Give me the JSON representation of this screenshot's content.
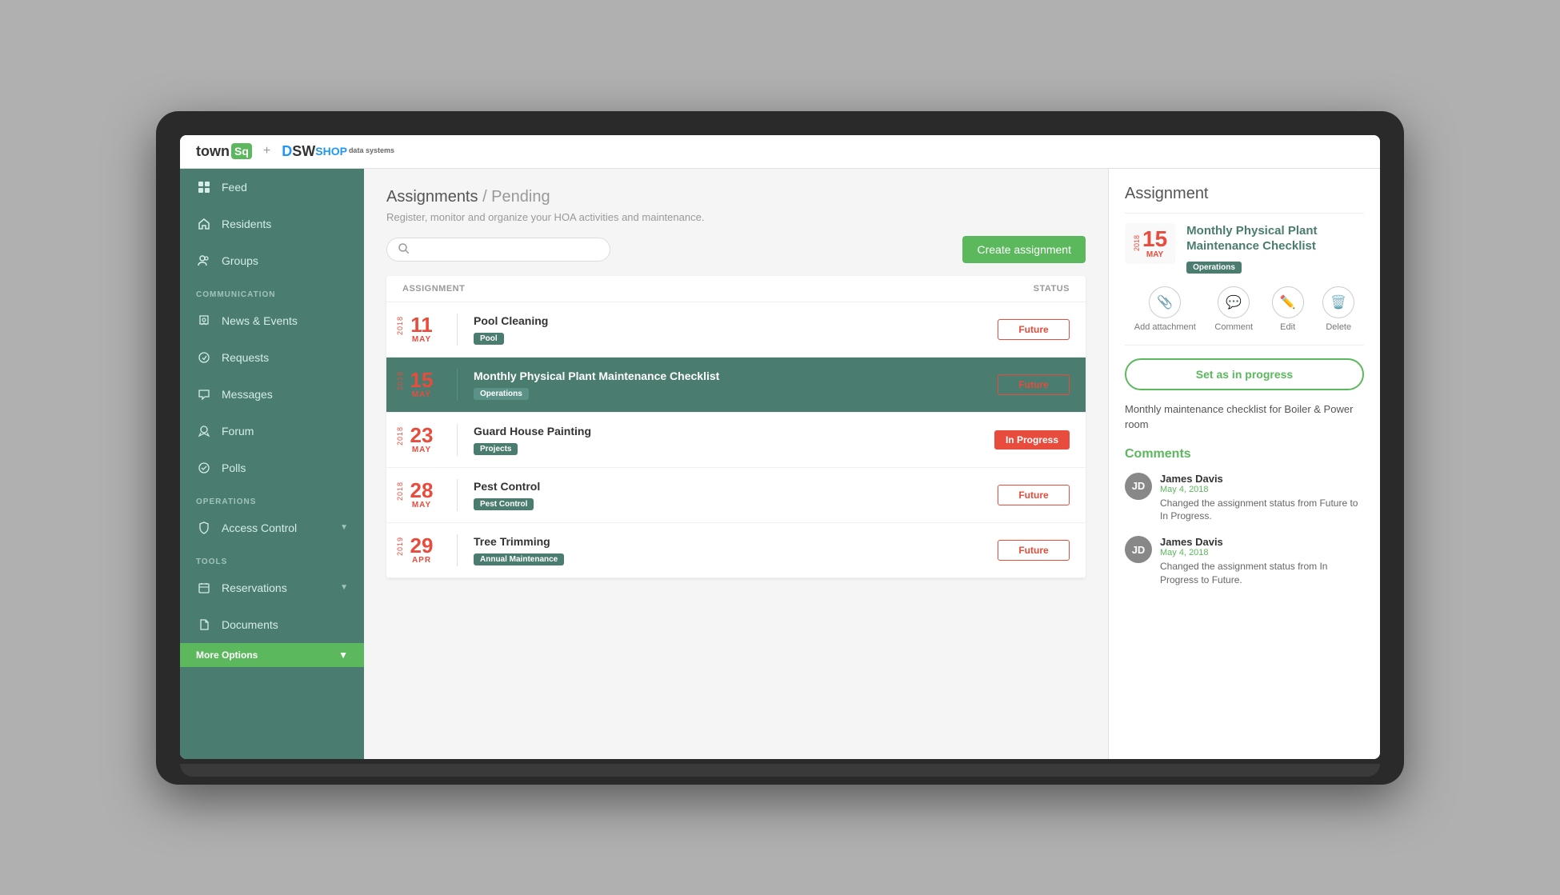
{
  "app": {
    "top_bar": {
      "logo_town": "town",
      "logo_sq": "Sq",
      "plus": "+",
      "dsw_d": "D",
      "dsw_s": "S",
      "dsw_w": "W",
      "dsw_shop": "SHOP",
      "dsw_sub": "data systems"
    }
  },
  "sidebar": {
    "items": [
      {
        "id": "feed",
        "label": "Feed",
        "icon": "grid-icon"
      },
      {
        "id": "residents",
        "label": "Residents",
        "icon": "home-icon"
      },
      {
        "id": "groups",
        "label": "Groups",
        "icon": "groups-icon"
      }
    ],
    "sections": [
      {
        "label": "COMMUNICATION",
        "items": [
          {
            "id": "news-events",
            "label": "News & Events",
            "icon": "news-icon"
          },
          {
            "id": "requests",
            "label": "Requests",
            "icon": "requests-icon"
          },
          {
            "id": "messages",
            "label": "Messages",
            "icon": "messages-icon"
          },
          {
            "id": "forum",
            "label": "Forum",
            "icon": "forum-icon"
          },
          {
            "id": "polls",
            "label": "Polls",
            "icon": "polls-icon"
          }
        ]
      },
      {
        "label": "OPERATIONS",
        "items": [
          {
            "id": "access-control",
            "label": "Access Control",
            "icon": "access-icon",
            "has_arrow": true
          }
        ]
      },
      {
        "label": "TOOLS",
        "items": [
          {
            "id": "reservations",
            "label": "Reservations",
            "icon": "reservations-icon",
            "has_arrow": true
          },
          {
            "id": "documents",
            "label": "Documents",
            "icon": "documents-icon"
          }
        ]
      }
    ],
    "more_options": "More Options",
    "more_arrow": "▼"
  },
  "main": {
    "breadcrumb": "Assignments / Pending",
    "subtitle": "Register, monitor and organize your HOA activities and maintenance.",
    "search_placeholder": "",
    "create_button": "Create assignment",
    "table_headers": {
      "assignment": "ASSIGNMENT",
      "status": "STATUS"
    },
    "assignments": [
      {
        "id": 1,
        "year": "2018",
        "day": "11",
        "month": "MAY",
        "title": "Pool Cleaning",
        "tag": "Pool",
        "status": "Future",
        "status_type": "future",
        "selected": false
      },
      {
        "id": 2,
        "year": "2018",
        "day": "15",
        "month": "MAY",
        "title": "Monthly Physical Plant Maintenance Checklist",
        "tag": "Operations",
        "status": "Future",
        "status_type": "future",
        "selected": true
      },
      {
        "id": 3,
        "year": "2018",
        "day": "23",
        "month": "MAY",
        "title": "Guard House Painting",
        "tag": "Projects",
        "status": "In Progress",
        "status_type": "inprogress",
        "selected": false
      },
      {
        "id": 4,
        "year": "2018",
        "day": "28",
        "month": "MAY",
        "title": "Pest Control",
        "tag": "Pest Control",
        "status": "Future",
        "status_type": "future",
        "selected": false
      },
      {
        "id": 5,
        "year": "2019",
        "day": "29",
        "month": "APR",
        "title": "Tree Trimming",
        "tag": "Annual Maintenance",
        "status": "Future",
        "status_type": "future",
        "selected": false
      }
    ]
  },
  "panel": {
    "title": "Assignment",
    "assignment": {
      "year": "2018",
      "day": "15",
      "month": "MAY",
      "title": "Monthly Physical Plant Maintenance Checklist",
      "tag": "Operations"
    },
    "actions": [
      {
        "id": "add-attachment",
        "icon": "📎",
        "label": "Add attachment"
      },
      {
        "id": "comment",
        "icon": "💬",
        "label": "Comment"
      },
      {
        "id": "edit",
        "icon": "✏️",
        "label": "Edit"
      },
      {
        "id": "delete",
        "icon": "🗑️",
        "label": "Delete"
      }
    ],
    "set_progress_button": "Set as in progress",
    "description": "Monthly maintenance checklist for Boiler & Power room",
    "comments_title": "Comments",
    "comments": [
      {
        "id": 1,
        "author": "James Davis",
        "date": "May 4, 2018",
        "text": "Changed the assignment status from Future to In Progress.",
        "avatar_initials": "JD"
      },
      {
        "id": 2,
        "author": "James Davis",
        "date": "May 4, 2018",
        "text": "Changed the assignment status from In Progress to Future.",
        "avatar_initials": "JD"
      }
    ]
  }
}
